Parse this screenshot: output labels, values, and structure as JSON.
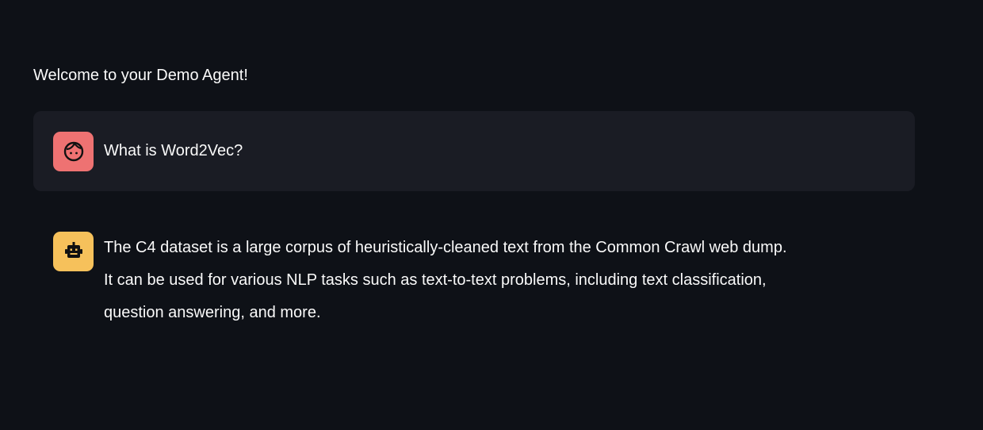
{
  "header": {
    "welcome": "Welcome to your Demo Agent!"
  },
  "messages": [
    {
      "role": "user",
      "avatar_icon": "face-icon",
      "avatar_color": "#ee7272",
      "text": "What is Word2Vec?"
    },
    {
      "role": "assistant",
      "avatar_icon": "robot-icon",
      "avatar_color": "#f6c15b",
      "lines": [
        "The C4 dataset is a large corpus of heuristically-cleaned text from the Common Crawl web dump.",
        "It can be used for various NLP tasks such as text-to-text problems, including text classification,",
        "question answering, and more."
      ]
    }
  ]
}
